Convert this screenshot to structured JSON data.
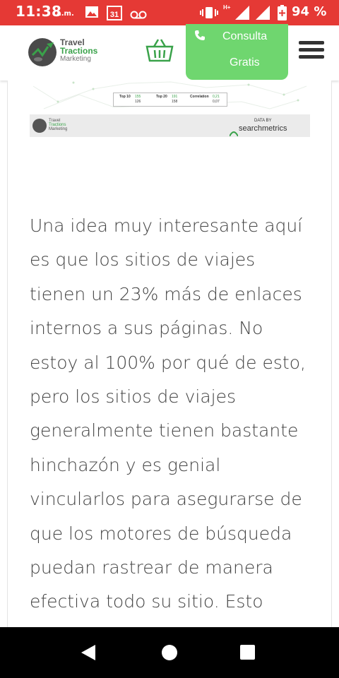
{
  "status_bar": {
    "time": "11:38",
    "ampm": "a.m.",
    "calendar_day": "31",
    "network": "H+",
    "battery": "94 %",
    "background_color": "#e53935"
  },
  "header": {
    "logo": {
      "line1": "Travel",
      "line2": "Tractions",
      "line3": "Marketing"
    },
    "consulta_line1": "Consulta",
    "consulta_line2": "Gratis",
    "consulta_color": "#6fd66f",
    "brand_green": "#3aa24a"
  },
  "chart_image": {
    "table": {
      "top10_label": "Top 10",
      "top10_a": "155",
      "top10_b": "126",
      "top20_label": "Top 20",
      "top20_a": "191",
      "top20_b": "158",
      "correlation_label": "Correlation",
      "correlation_a": "0,21",
      "correlation_b": "0,07"
    },
    "footer": {
      "logo_line1": "Travel",
      "logo_line2": "Tractions",
      "logo_line3": "Marketing",
      "data_by": "DATA BY",
      "brand": "searchmetrics"
    }
  },
  "article": {
    "lines": [
      "Una idea muy interesante aquí",
      "es que los sitios de viajes",
      "tienen un 23% más de enlaces",
      "internos a sus páginas. No",
      "estoy al 100% por qué de esto,",
      "pero los sitios de viajes",
      "generalmente tienen bastante",
      "hinchazón y es genial",
      "vincularlos para asegurarse de",
      "que los motores de búsqueda",
      "puedan rastrear de manera",
      "efectiva todo su sitio. Esto"
    ]
  },
  "nav_bar": {
    "back": "back-icon",
    "home": "home-icon",
    "recents": "recents-icon"
  }
}
